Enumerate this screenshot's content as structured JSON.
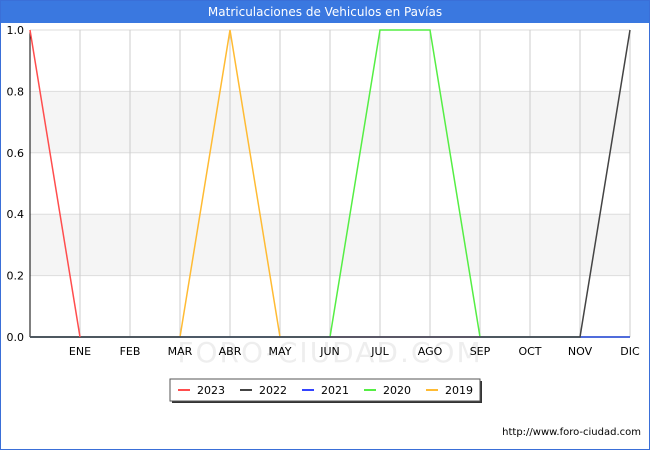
{
  "title": "Matriculaciones de Vehiculos en Pavías",
  "source_url": "http://www.foro-ciudad.com",
  "watermark": "FORO-CIUDAD.COM",
  "chart_data": {
    "type": "line",
    "title": "Matriculaciones de Vehiculos en Pavías",
    "categories": [
      "",
      "ENE",
      "FEB",
      "MAR",
      "ABR",
      "MAY",
      "JUN",
      "JUL",
      "AGO",
      "SEP",
      "OCT",
      "NOV",
      "DIC"
    ],
    "ylim": [
      0,
      1
    ],
    "yticks": [
      "0.0",
      "0.2",
      "0.4",
      "0.6",
      "0.8",
      "1.0"
    ],
    "grid": true,
    "legend_position": "bottom",
    "series": [
      {
        "name": "2023",
        "color": "#ff4d4d",
        "values": [
          1,
          0,
          null,
          null,
          null,
          null,
          null,
          null,
          null,
          null,
          null,
          null,
          null
        ]
      },
      {
        "name": "2022",
        "color": "#444444",
        "values": [
          0,
          0,
          0,
          0,
          0,
          0,
          0,
          0,
          0,
          0,
          0,
          0,
          1
        ]
      },
      {
        "name": "2021",
        "color": "#3344ff",
        "values": [
          0,
          0,
          0,
          0,
          0,
          0,
          0,
          0,
          0,
          0,
          0,
          0,
          0
        ]
      },
      {
        "name": "2020",
        "color": "#55ee44",
        "values": [
          0,
          0,
          0,
          0,
          0,
          0,
          0,
          1,
          1,
          0,
          0,
          0,
          0
        ]
      },
      {
        "name": "2019",
        "color": "#ffbb33",
        "values": [
          0,
          0,
          0,
          0,
          1,
          0,
          0,
          0,
          0,
          0,
          0,
          0,
          0
        ]
      }
    ]
  }
}
